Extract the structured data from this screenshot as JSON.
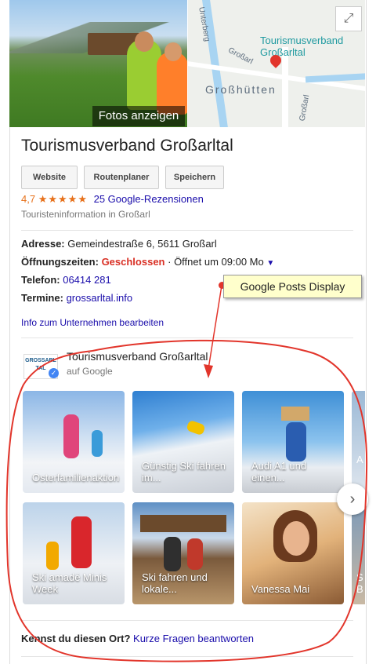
{
  "photo": {
    "button_label": "Fotos anzeigen"
  },
  "map": {
    "business_name_line1": "Tourismusverband",
    "business_name_line2": "Großarltal",
    "label_town": "Großhütten",
    "label_road_upper": "Unterberg",
    "label_road_small": "Großarl",
    "label_road_right": "Großarl"
  },
  "business": {
    "name": "Tourismusverband Großarltal",
    "buttons": [
      "Website",
      "Routenplaner",
      "Speichern"
    ],
    "rating": "4,7",
    "stars": "★★★★★",
    "reviews": "25 Google-Rezensionen",
    "category": "Touristeninformation in Großarl"
  },
  "details": {
    "address_label": "Adresse:",
    "address_value": "Gemeindestraße 6, 5611 Großarl",
    "hours_label": "Öffnungszeiten:",
    "hours_status": "Geschlossen",
    "hours_next": "· Öffnet um 09:00 Mo",
    "phone_label": "Telefon:",
    "phone_value": "06414 281",
    "appointments_label": "Termine:",
    "appointments_value": "grossarltal.info",
    "edit_link": "Info zum Unternehmen bearbeiten"
  },
  "posts": {
    "logo_text": "GROSSARL TAL",
    "title": "Tourismusverband Großarltal",
    "subtitle": "auf Google",
    "cards": [
      {
        "label": "Osterfamilienaktion"
      },
      {
        "label": "Günstig Ski fahren im..."
      },
      {
        "label": "Audi A1 und einen..."
      },
      {
        "label": "Ski amadé Minis Week"
      },
      {
        "label": "Ski fahren und lokale..."
      },
      {
        "label": "Vanessa Mai"
      }
    ],
    "peek_card_1": "A",
    "peek_card_2": "S\nB"
  },
  "annotation": {
    "callout": "Google Posts Display",
    "color": "#e2352b"
  },
  "questions": {
    "prompt": "Kennst du diesen Ort?",
    "link": "Kurze Fragen beantworten"
  }
}
